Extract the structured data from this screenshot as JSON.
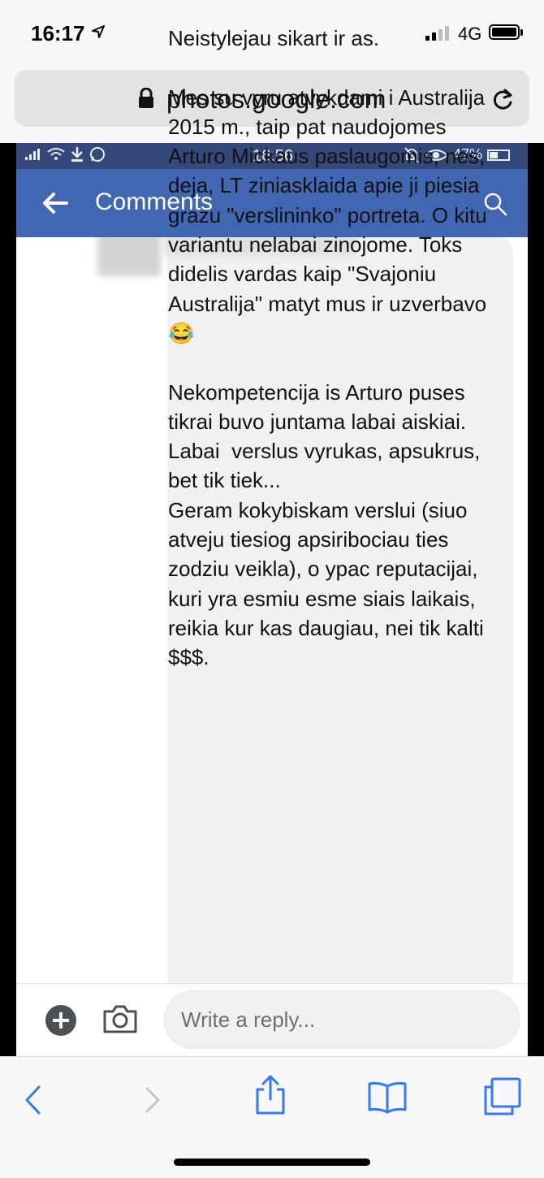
{
  "ios_status": {
    "time": "16:17",
    "network": "4G"
  },
  "browser": {
    "url": "photos.google.com"
  },
  "android_status": {
    "time": "16:56",
    "battery": "47%"
  },
  "header": {
    "title": "Comments"
  },
  "comment": {
    "text": "Neistylejau sikart ir as.\n\nMes su vyru atvykdami i Australija 2015 m., taip pat naudojomes Arturo Mickaus paslaugomis, nes, deja, LT ziniasklaida apie ji piesia grazu \"verslininko\" portreta. O kitu variantu nelabai zinojome. Toks didelis vardas kaip \"Svajoniu Australija\" matyt mus ir uzverbavo😂\n\nNekompetencija is Arturo puses tikrai buvo juntama labai aiskiai.\nLabai  verslus vyrukas, apsukrus, bet tik tiek...\nGeram kokybiskam verslui (siuo atveju tiesiog apsiribociau ties zodziu veikla), o ypac reputacijai, kuri yra esmiu esme siais laikais, reikia kur kas daugiau, nei tik kalti $$$."
  },
  "reply": {
    "placeholder": "Write a reply..."
  },
  "colors": {
    "facebook_blue": "#4267b2",
    "android_status": "#34497a",
    "safari_blue": "#3478f6"
  }
}
